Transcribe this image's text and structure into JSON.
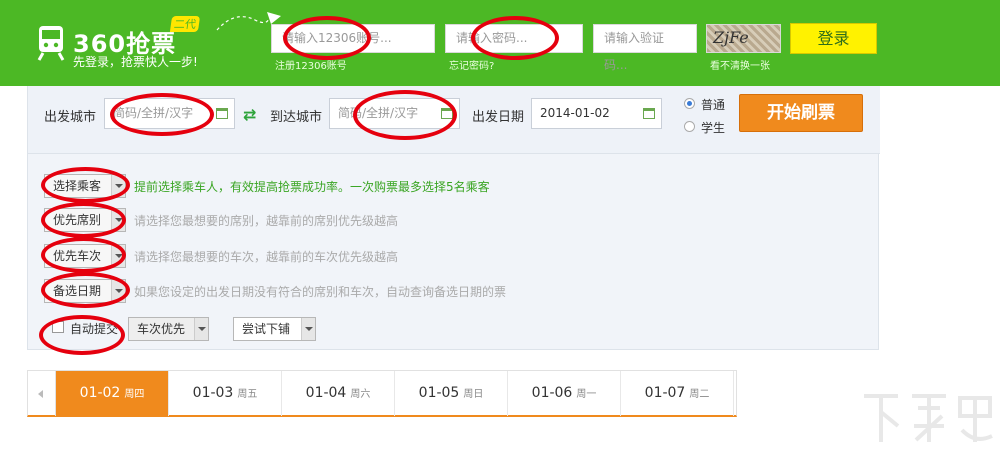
{
  "header": {
    "brand": "360抢票",
    "badge": "二代",
    "slogan": "先登录，抢票快人一步!",
    "account_placeholder": "请输入12306账号...",
    "register_link": "注册12306账号",
    "password_placeholder": "请输入密码...",
    "forgot_link": "忘记密码?",
    "captcha_placeholder": "请输入验证码...",
    "captcha_text": "ZjFe",
    "refresh_link": "看不清换一张",
    "login_label": "登录",
    "colors": {
      "header_green": "#4cb825",
      "login_yellow": "#fff200"
    }
  },
  "search": {
    "from_label": "出发城市",
    "from_placeholder": "简码/全拼/汉字",
    "to_label": "到达城市",
    "to_placeholder": "简码/全拼/汉字",
    "date_label": "出发日期",
    "date_value": "2014-01-02",
    "ticket_types": [
      "普通",
      "学生"
    ],
    "selected_type": "普通",
    "start_label": "开始刷票",
    "swap_icon": "swap-arrows-icon",
    "calendar_icon": "calendar-icon"
  },
  "options": {
    "passenger_label": "选择乘客",
    "passenger_hint": "提前选择乘车人，有效提高抢票成功率。一次购票最多选择5名乘客",
    "seat_label": "优先席别",
    "seat_hint": "请选择您最想要的席别，越靠前的席别优先级越高",
    "train_label": "优先车次",
    "train_hint": "请选择您最想要的车次，越靠前的车次优先级越高",
    "backup_label": "备选日期",
    "backup_hint": "如果您设定的出发日期没有符合的席别和车次，自动查询备选日期的票",
    "auto_submit_label": "自动提交",
    "auto_submit_checked": false,
    "priority_select": "车次优先",
    "berth_select": "尝试下铺"
  },
  "dates": {
    "active_index": 0,
    "tabs": [
      {
        "date": "01-02",
        "weekday": "周四"
      },
      {
        "date": "01-03",
        "weekday": "周五"
      },
      {
        "date": "01-04",
        "weekday": "周六"
      },
      {
        "date": "01-05",
        "weekday": "周日"
      },
      {
        "date": "01-06",
        "weekday": "周一"
      },
      {
        "date": "01-07",
        "weekday": "周二"
      }
    ]
  },
  "watermark": {
    "text": "下载吧"
  }
}
